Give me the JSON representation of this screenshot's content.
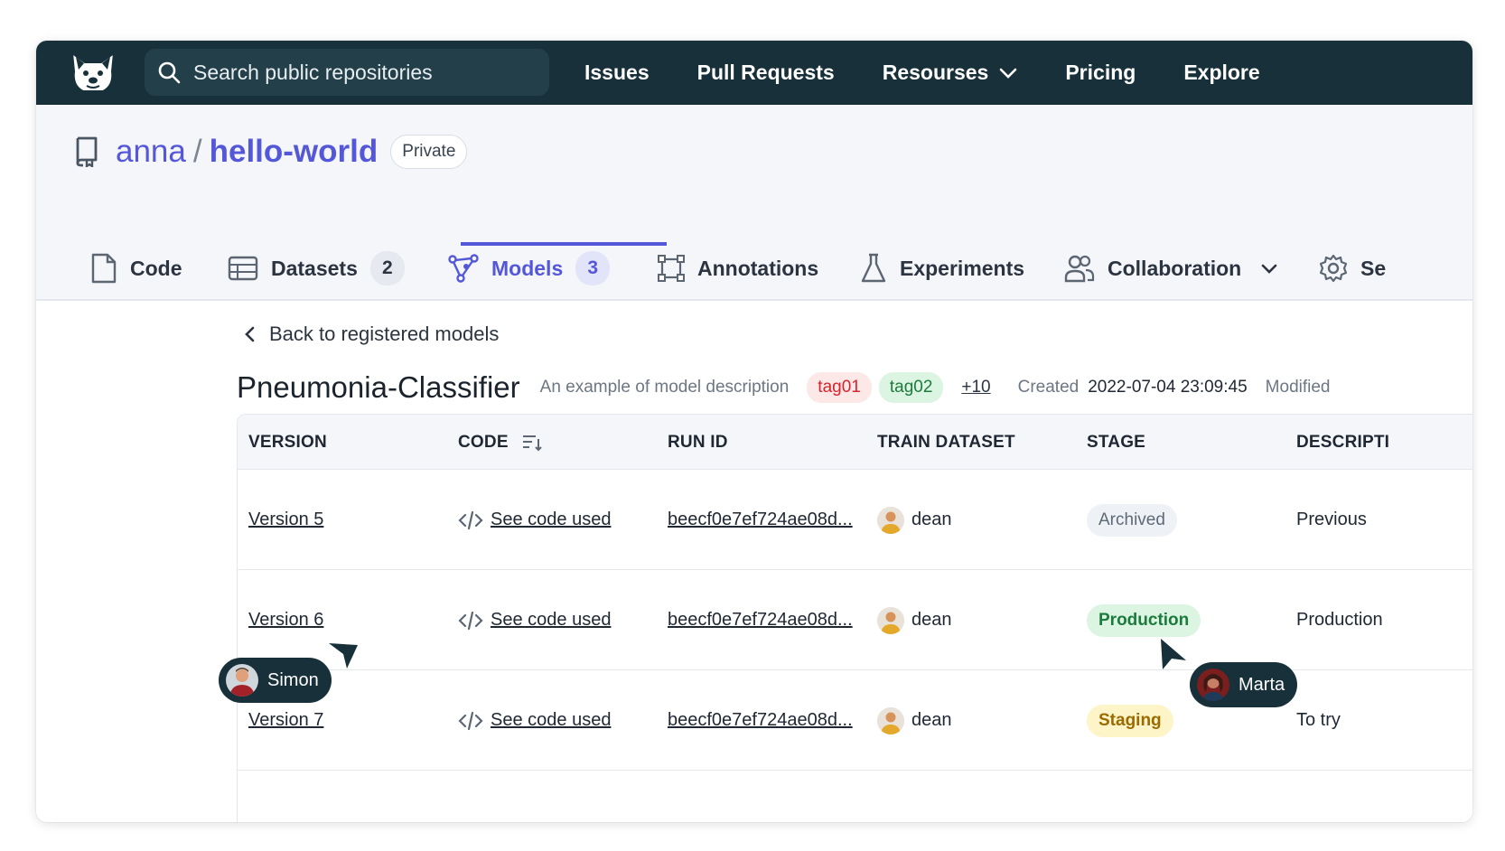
{
  "nav": {
    "search_placeholder": "Search public repositories",
    "links": [
      "Issues",
      "Pull Requests",
      "Resourses",
      "Pricing",
      "Explore"
    ]
  },
  "repo": {
    "owner": "anna",
    "separator": "/",
    "name": "hello-world",
    "visibility": "Private"
  },
  "tabs": [
    {
      "label": "Code",
      "count": ""
    },
    {
      "label": "Datasets",
      "count": "2"
    },
    {
      "label": "Models",
      "count": "3"
    },
    {
      "label": "Annotations",
      "count": ""
    },
    {
      "label": "Experiments",
      "count": ""
    },
    {
      "label": "Collaboration",
      "count": ""
    },
    {
      "label": "Se",
      "count": ""
    }
  ],
  "back_label": "Back to registered models",
  "model": {
    "name": "Pneumonia-Classifier",
    "description": "An example of model description",
    "tags": [
      "tag01",
      "tag02"
    ],
    "more_tags": "+10",
    "created_label": "Created",
    "created_value": "2022-07-04 23:09:45",
    "modified_label": "Modified"
  },
  "table": {
    "headers": [
      "VERSION",
      "CODE",
      "RUN ID",
      "TRAIN DATASET",
      "STAGE",
      "DESCRIPTI"
    ],
    "rows": [
      {
        "version": "Version 5",
        "code": "See code used",
        "run_id": "beecf0e7ef724ae08d...",
        "user": "dean",
        "stage": "Archived",
        "description": "Previous"
      },
      {
        "version": "Version 6",
        "code": "See code used",
        "run_id": "beecf0e7ef724ae08d...",
        "user": "dean",
        "stage": "Production",
        "description": "Production"
      },
      {
        "version": "Version 7",
        "code": "See code used",
        "run_id": "beecf0e7ef724ae08d...",
        "user": "dean",
        "stage": "Staging",
        "description": "To try"
      }
    ]
  },
  "cursors": [
    {
      "name": "Simon"
    },
    {
      "name": "Marta"
    }
  ],
  "colors": {
    "nav_bg": "#17303a",
    "accent": "#5458d8",
    "production": "#1d7a3d",
    "staging": "#9b6a00",
    "tag_red": "#d6242d"
  }
}
